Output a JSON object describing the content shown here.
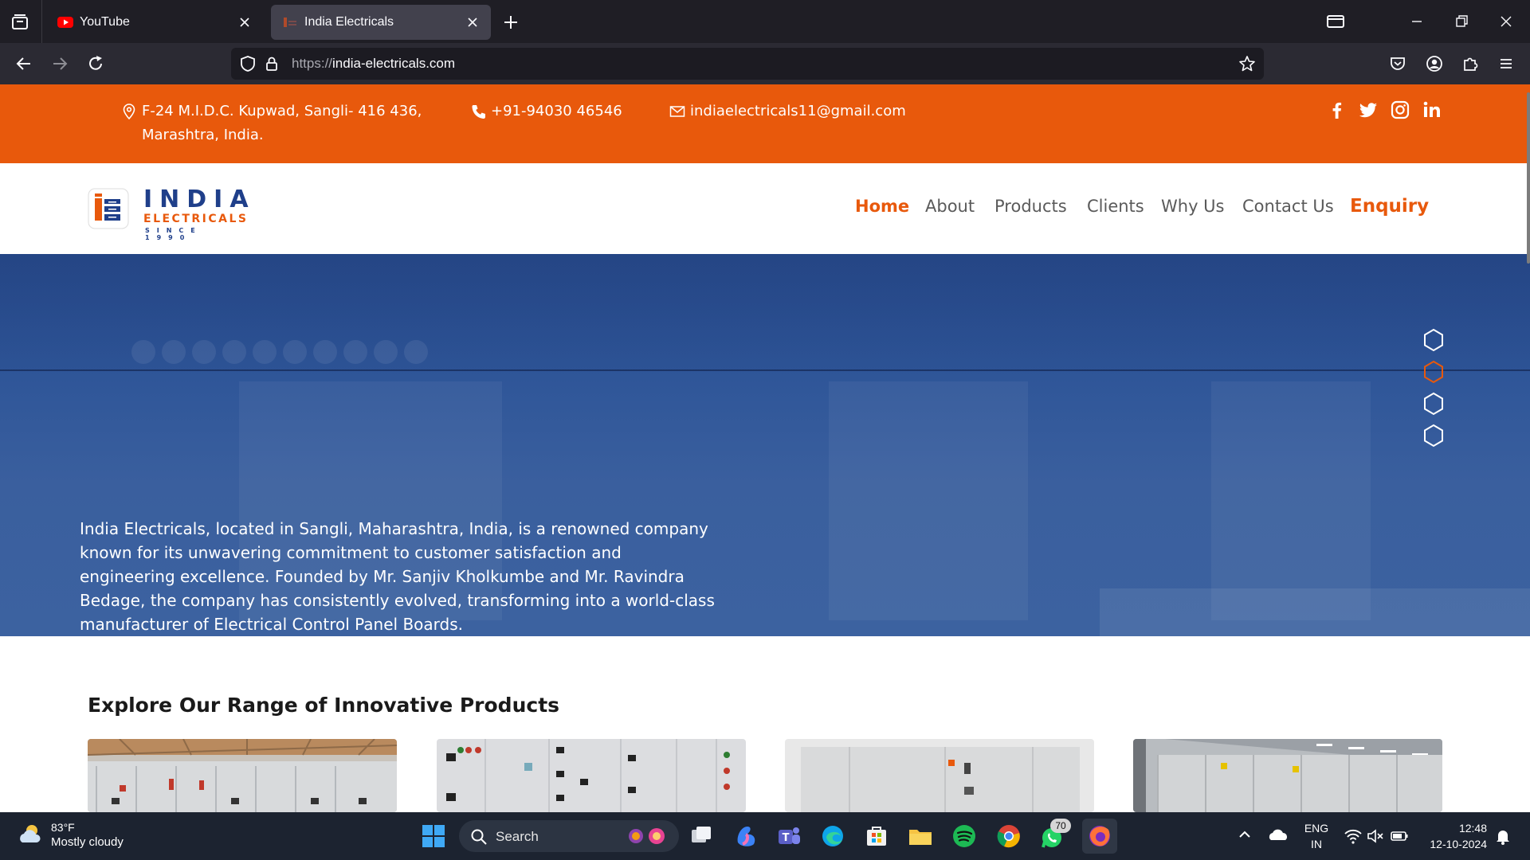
{
  "browser": {
    "tabs": [
      {
        "title": "YouTube",
        "favicon": "youtube-icon",
        "active": false
      },
      {
        "title": "India Electricals",
        "favicon": "site-icon",
        "active": true
      }
    ],
    "url_protocol": "https://",
    "url_host": "india-electricals.com"
  },
  "site": {
    "contact": {
      "address_line1": "F-24 M.I.D.C. Kupwad, Sangli- 416 436,",
      "address_line2": "Marashtra, India.",
      "phone": "+91-94030 46546",
      "email": "indiaelectricals11@gmail.com"
    },
    "social": [
      "facebook-icon",
      "twitter-icon",
      "instagram-icon",
      "linkedin-icon"
    ],
    "logo": {
      "word": "INDIA",
      "sub": "ELECTRICALS",
      "since": "SINCE 1990"
    },
    "nav": [
      {
        "label": "Home",
        "active": true
      },
      {
        "label": "About"
      },
      {
        "label": "Products"
      },
      {
        "label": "Clients"
      },
      {
        "label": "Why Us"
      },
      {
        "label": "Contact Us"
      },
      {
        "label": "Enquiry"
      }
    ],
    "hero_text": "India Electricals, located in Sangli, Maharashtra, India, is a renowned company known for its unwavering commitment to customer satisfaction and engineering excellence. Founded by Mr. Sanjiv Kholkumbe and Mr. Ravindra Bedage, the company has consistently evolved, transforming into a world-class manufacturer of Electrical Control Panel Boards.",
    "slider_active_index": 1,
    "slider_count": 4,
    "section_title": "Explore Our Range of Innovative Products"
  },
  "taskbar": {
    "weather_temp": "83°F",
    "weather_cond": "Mostly cloudy",
    "search_label": "Search",
    "whatsapp_badge": "70",
    "lang_line1": "ENG",
    "lang_line2": "IN",
    "time": "12:48",
    "date": "12-10-2024"
  },
  "colors": {
    "accent": "#e8590c",
    "brand_blue": "#1f3f8a",
    "hero": "#2e5598"
  }
}
